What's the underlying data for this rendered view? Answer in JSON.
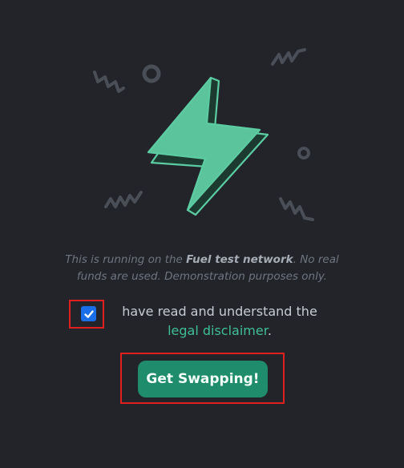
{
  "notice": {
    "prefix": "This is running on the ",
    "network": "Fuel test network",
    "suffix": ". No real funds are used. Demonstration purposes only."
  },
  "disclaimer": {
    "checked": true,
    "text": "have read and understand the ",
    "link_label": "legal disclaimer",
    "end": "."
  },
  "cta": {
    "label": "Get Swapping!"
  },
  "colors": {
    "background": "#22242a",
    "accent": "#3fbf94",
    "button": "#1f8c6b",
    "highlight": "#e01f1f"
  }
}
